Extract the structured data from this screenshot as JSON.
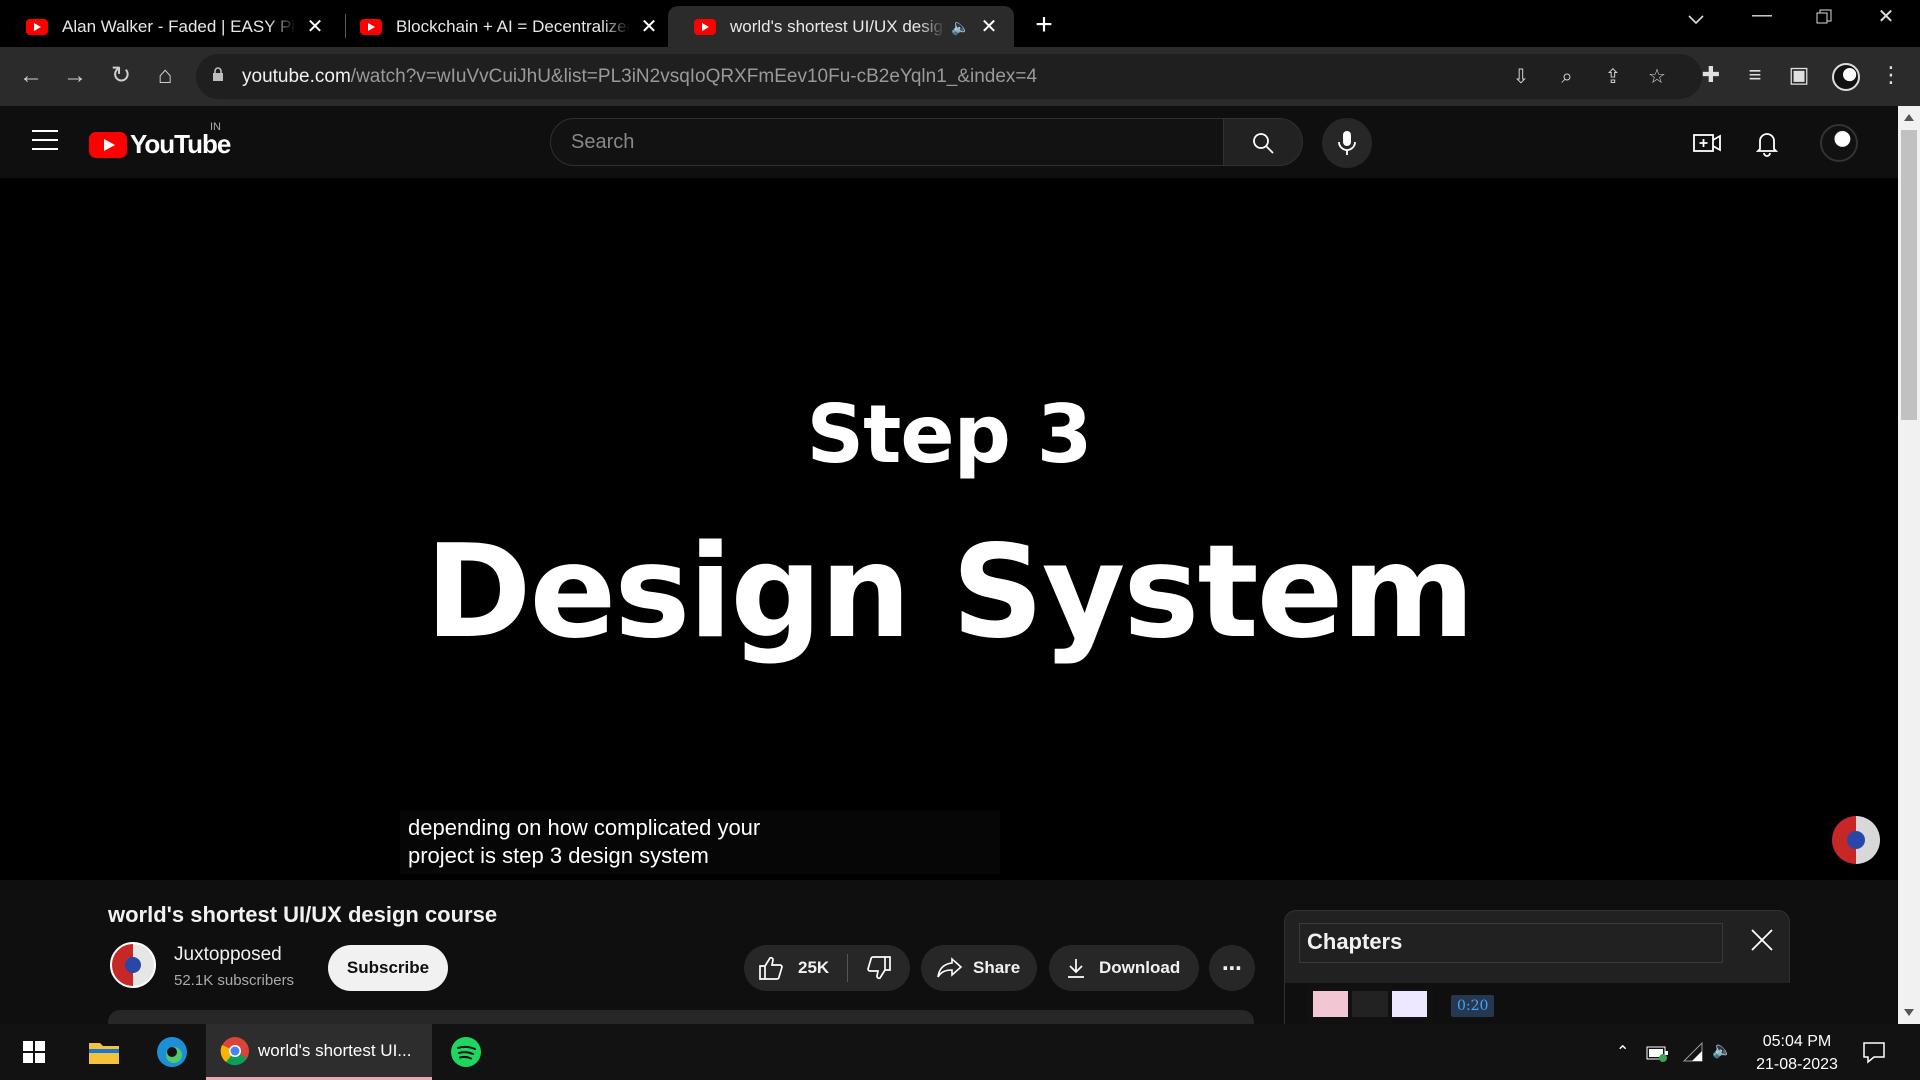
{
  "browser": {
    "tabs": [
      {
        "title": "Alan Walker - Faded | EASY Piano Tutorial",
        "active": false
      },
      {
        "title": "Blockchain + AI = Decentralized AI",
        "active": false
      },
      {
        "title": "world's shortest UI/UX design course",
        "active": true,
        "audio": true
      }
    ],
    "url_host": "youtube.com",
    "url_path": "/watch?v=wIuVvCuiJhU&list=PL3iN2vsqIoQRXFmEev10Fu-cB2eYqln1_&index=4"
  },
  "youtube": {
    "logo_text": "YouTube",
    "country_code": "IN",
    "search_placeholder": "Search"
  },
  "video": {
    "frame_line1": "Step 3",
    "frame_line2": "Design System",
    "caption_line1": "depending on how complicated your",
    "caption_line2": "project is step 3 design system",
    "title": "world's shortest UI/UX design course",
    "channel_name": "Juxtopposed",
    "subscribers": "52.1K subscribers",
    "subscribe_label": "Subscribe",
    "likes": "25K",
    "share_label": "Share",
    "download_label": "Download"
  },
  "chapters": {
    "heading": "Chapters",
    "first_time": "0:20"
  },
  "taskbar": {
    "active_app_label": "world's shortest UI...",
    "time": "05:04 PM",
    "date": "21-08-2023"
  },
  "colors": {
    "youtube_red": "#ff0000",
    "chapter_time_blue": "#3ea6ff"
  }
}
